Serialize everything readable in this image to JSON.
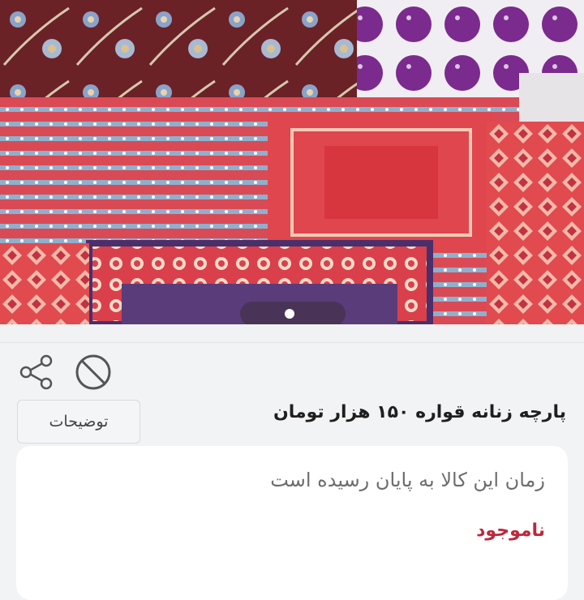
{
  "product": {
    "title": "پارچه زنانه قواره ۱۵۰ هزار تومان",
    "description_button_label": "توضیحات"
  },
  "gallery": {
    "image_name": "fabric-patterns-photo",
    "total_images": 1,
    "active_index": 1
  },
  "actions": {
    "share_icon": "share-icon",
    "block_icon": "prohibit-icon"
  },
  "status_card": {
    "notice": "زمان این کالا به پایان رسیده است",
    "stock_label": "ناموجود",
    "stock_color": "#c0273a"
  }
}
